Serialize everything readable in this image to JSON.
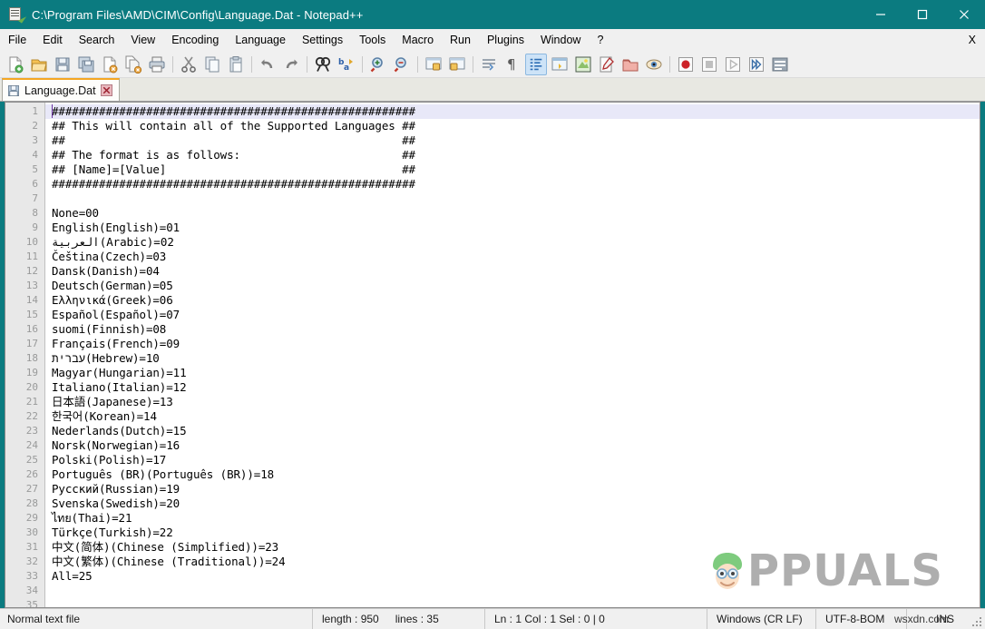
{
  "window": {
    "title": "C:\\Program Files\\AMD\\CIM\\Config\\Language.Dat - Notepad++",
    "app_icon": "notepad-plus-plus-icon",
    "controls": {
      "minimize": "minimize-icon",
      "maximize": "maximize-icon",
      "close": "close-icon"
    },
    "title_bar_color": "#0b7b80"
  },
  "menubar": {
    "items": [
      {
        "label": "File"
      },
      {
        "label": "Edit"
      },
      {
        "label": "Search"
      },
      {
        "label": "View"
      },
      {
        "label": "Encoding"
      },
      {
        "label": "Language"
      },
      {
        "label": "Settings"
      },
      {
        "label": "Tools"
      },
      {
        "label": "Macro"
      },
      {
        "label": "Run"
      },
      {
        "label": "Plugins"
      },
      {
        "label": "Window"
      },
      {
        "label": "?"
      }
    ],
    "close_document_label": "X"
  },
  "toolbar": {
    "buttons": [
      {
        "name": "new-file-icon"
      },
      {
        "name": "open-file-icon"
      },
      {
        "name": "save-icon"
      },
      {
        "name": "save-all-icon"
      },
      {
        "name": "close-file-icon"
      },
      {
        "name": "close-all-files-icon"
      },
      {
        "name": "print-icon"
      },
      {
        "name": "cut-icon"
      },
      {
        "name": "copy-icon"
      },
      {
        "name": "paste-icon"
      },
      {
        "name": "undo-icon"
      },
      {
        "name": "redo-icon"
      },
      {
        "name": "find-icon"
      },
      {
        "name": "replace-icon"
      },
      {
        "name": "zoom-in-icon"
      },
      {
        "name": "zoom-out-icon"
      },
      {
        "name": "sync-vertical-scroll-icon"
      },
      {
        "name": "sync-horizontal-scroll-icon"
      },
      {
        "name": "word-wrap-icon"
      },
      {
        "name": "show-all-characters-icon"
      },
      {
        "name": "show-indent-guide-icon"
      },
      {
        "name": "show-ui-icon"
      },
      {
        "name": "user-defined-language-icon"
      },
      {
        "name": "document-map-icon"
      },
      {
        "name": "function-list-icon"
      },
      {
        "name": "document-switcher-icon"
      },
      {
        "name": "record-macro-icon"
      },
      {
        "name": "stop-macro-icon"
      },
      {
        "name": "play-macro-icon"
      },
      {
        "name": "run-macro-multiple-icon"
      },
      {
        "name": "run-dialog-icon"
      }
    ]
  },
  "tabs": [
    {
      "label": "Language.Dat",
      "save_icon": "tab-save-icon",
      "close_icon": "tab-close-icon",
      "active": true
    }
  ],
  "editor": {
    "current_line": 1,
    "line_numbers": [
      1,
      2,
      3,
      4,
      5,
      6,
      7,
      8,
      9,
      10,
      11,
      12,
      13,
      14,
      15,
      16,
      17,
      18,
      19,
      20,
      21,
      22,
      23,
      24,
      25,
      26,
      27,
      28,
      29,
      30,
      31,
      32,
      33,
      34,
      35
    ],
    "lines": [
      "######################################################",
      "## This will contain all of the Supported Languages ##",
      "##                                                  ##",
      "## The format is as follows:                        ##",
      "## [Name]=[Value]                                   ##",
      "######################################################",
      "",
      "None=00",
      "English(English)=01",
      "العربية(Arabic)=02",
      "Čeština(Czech)=03",
      "Dansk(Danish)=04",
      "Deutsch(German)=05",
      "Ελληνικά(Greek)=06",
      "Español(Español)=07",
      "suomi(Finnish)=08",
      "Français(French)=09",
      "עברית(Hebrew)=10",
      "Magyar(Hungarian)=11",
      "Italiano(Italian)=12",
      "日本語(Japanese)=13",
      "한국어(Korean)=14",
      "Nederlands(Dutch)=15",
      "Norsk(Norwegian)=16",
      "Polski(Polish)=17",
      "Português (BR)(Português (BR))=18",
      "Русский(Russian)=19",
      "Svenska(Swedish)=20",
      "ไทย(Thai)=21",
      "Türkçe(Turkish)=22",
      "中文(简体)(Chinese (Simplified))=23",
      "中文(繁体)(Chinese (Traditional))=24",
      "All=25",
      "",
      ""
    ]
  },
  "statusbar": {
    "file_type": "Normal text file",
    "length_label": "length : 950",
    "lines_label": "lines : 35",
    "position": "Ln : 1    Col : 1    Sel : 0 | 0",
    "eol": "Windows (CR LF)",
    "encoding": "UTF-8-BOM",
    "insert_mode": "INS"
  },
  "watermarks": {
    "brand": "PPUALS",
    "brand_full": "APPUALS",
    "site": "wsxdn.com"
  }
}
